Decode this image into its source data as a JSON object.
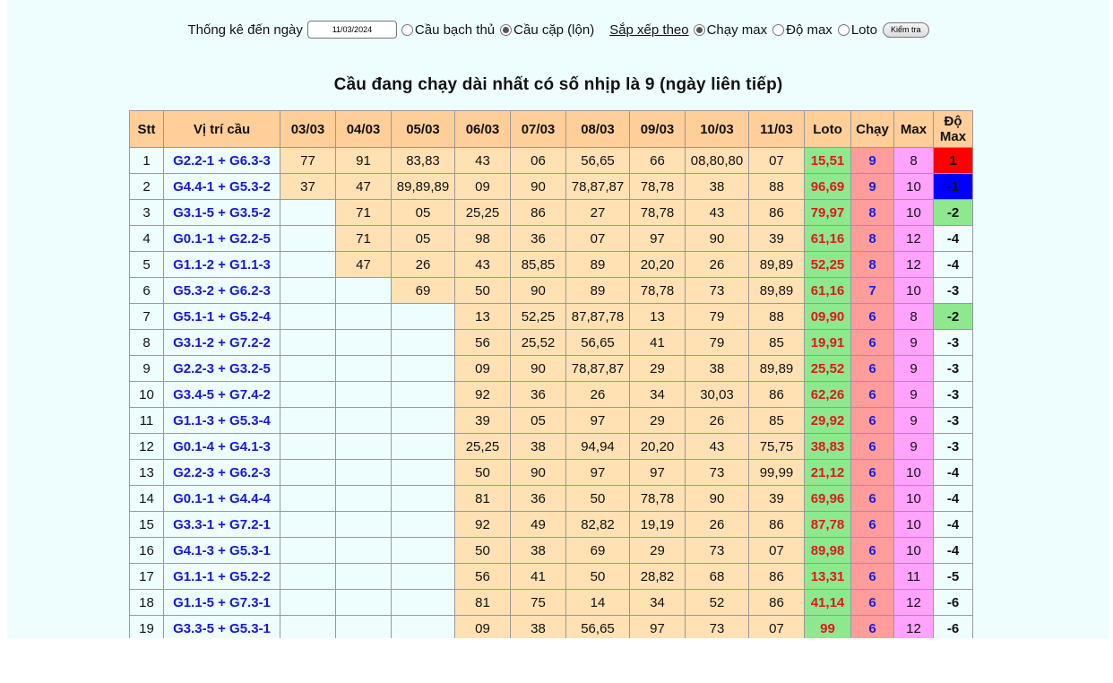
{
  "filter": {
    "date_label": "Thống kê đến ngày",
    "date_value": "11/03/2024",
    "mode_options": [
      {
        "label": "Cầu bạch thủ",
        "checked": false
      },
      {
        "label": "Cầu cặp (lộn)",
        "checked": true
      }
    ],
    "sort_label": "Sắp xếp theo",
    "sort_options": [
      {
        "label": "Chạy max",
        "checked": true
      },
      {
        "label": "Độ max",
        "checked": false
      },
      {
        "label": "Loto",
        "checked": false
      }
    ],
    "check_button": "Kiểm tra"
  },
  "title": "Cầu đang chạy dài nhất có số nhịp là 9 (ngày liên tiếp)",
  "table": {
    "headers": [
      "Stt",
      "Vị trí cầu",
      "03/03",
      "04/03",
      "05/03",
      "06/03",
      "07/03",
      "08/03",
      "09/03",
      "10/03",
      "11/03",
      "Loto",
      "Chạy",
      "Max",
      "Độ Max"
    ],
    "rows": [
      {
        "stt": "1",
        "pos": "G2.2-1 + G6.3-3",
        "days": [
          "77",
          "91",
          "83,83",
          "43",
          "06",
          "56,65",
          "66",
          "08,80,80",
          "07"
        ],
        "loto": "15,51",
        "chay": "9",
        "max": "8",
        "domax": "1",
        "domax_bg": "#ff0000",
        "domax_color": "#111111"
      },
      {
        "stt": "2",
        "pos": "G4.4-1 + G5.3-2",
        "days": [
          "37",
          "47",
          "89,89,89",
          "09",
          "90",
          "78,87,87",
          "78,78",
          "38",
          "88"
        ],
        "loto": "96,69",
        "chay": "9",
        "max": "10",
        "domax": "-1",
        "domax_bg": "#0000ff",
        "domax_color": "#111111"
      },
      {
        "stt": "3",
        "pos": "G3.1-5 + G3.5-2",
        "days": [
          "",
          "71",
          "05",
          "25,25",
          "86",
          "27",
          "78,78",
          "43",
          "86"
        ],
        "loto": "79,97",
        "chay": "8",
        "max": "10",
        "domax": "-2",
        "domax_bg": "#8ee88e",
        "domax_color": "#111111"
      },
      {
        "stt": "4",
        "pos": "G0.1-1 + G2.2-5",
        "days": [
          "",
          "71",
          "05",
          "98",
          "36",
          "07",
          "97",
          "90",
          "39"
        ],
        "loto": "61,16",
        "chay": "8",
        "max": "12",
        "domax": "-4",
        "domax_bg": "",
        "domax_color": "#111111"
      },
      {
        "stt": "5",
        "pos": "G1.1-2 + G1.1-3",
        "days": [
          "",
          "47",
          "26",
          "43",
          "85,85",
          "89",
          "20,20",
          "26",
          "89,89"
        ],
        "loto": "52,25",
        "chay": "8",
        "max": "12",
        "domax": "-4",
        "domax_bg": "",
        "domax_color": "#111111"
      },
      {
        "stt": "6",
        "pos": "G5.3-2 + G6.2-3",
        "days": [
          "",
          "",
          "69",
          "50",
          "90",
          "89",
          "78,78",
          "73",
          "89,89"
        ],
        "loto": "61,16",
        "chay": "7",
        "max": "10",
        "domax": "-3",
        "domax_bg": "",
        "domax_color": "#111111"
      },
      {
        "stt": "7",
        "pos": "G5.1-1 + G5.2-4",
        "days": [
          "",
          "",
          "",
          "13",
          "52,25",
          "87,87,78",
          "13",
          "79",
          "88"
        ],
        "loto": "09,90",
        "chay": "6",
        "max": "8",
        "domax": "-2",
        "domax_bg": "#8ee88e",
        "domax_color": "#111111"
      },
      {
        "stt": "8",
        "pos": "G3.1-2 + G7.2-2",
        "days": [
          "",
          "",
          "",
          "56",
          "25,52",
          "56,65",
          "41",
          "79",
          "85"
        ],
        "loto": "19,91",
        "chay": "6",
        "max": "9",
        "domax": "-3",
        "domax_bg": "",
        "domax_color": "#111111"
      },
      {
        "stt": "9",
        "pos": "G2.2-3 + G3.2-5",
        "days": [
          "",
          "",
          "",
          "09",
          "90",
          "78,87,87",
          "29",
          "38",
          "89,89"
        ],
        "loto": "25,52",
        "chay": "6",
        "max": "9",
        "domax": "-3",
        "domax_bg": "",
        "domax_color": "#111111"
      },
      {
        "stt": "10",
        "pos": "G3.4-5 + G7.4-2",
        "days": [
          "",
          "",
          "",
          "92",
          "36",
          "26",
          "34",
          "30,03",
          "86"
        ],
        "loto": "62,26",
        "chay": "6",
        "max": "9",
        "domax": "-3",
        "domax_bg": "",
        "domax_color": "#111111"
      },
      {
        "stt": "11",
        "pos": "G1.1-3 + G5.3-4",
        "days": [
          "",
          "",
          "",
          "39",
          "05",
          "97",
          "29",
          "26",
          "85"
        ],
        "loto": "29,92",
        "chay": "6",
        "max": "9",
        "domax": "-3",
        "domax_bg": "",
        "domax_color": "#111111"
      },
      {
        "stt": "12",
        "pos": "G0.1-4 + G4.1-3",
        "days": [
          "",
          "",
          "",
          "25,25",
          "38",
          "94,94",
          "20,20",
          "43",
          "75,75"
        ],
        "loto": "38,83",
        "chay": "6",
        "max": "9",
        "domax": "-3",
        "domax_bg": "",
        "domax_color": "#111111"
      },
      {
        "stt": "13",
        "pos": "G2.2-3 + G6.2-3",
        "days": [
          "",
          "",
          "",
          "50",
          "90",
          "97",
          "97",
          "73",
          "99,99"
        ],
        "loto": "21,12",
        "chay": "6",
        "max": "10",
        "domax": "-4",
        "domax_bg": "",
        "domax_color": "#111111"
      },
      {
        "stt": "14",
        "pos": "G0.1-1 + G4.4-4",
        "days": [
          "",
          "",
          "",
          "81",
          "36",
          "50",
          "78,78",
          "90",
          "39"
        ],
        "loto": "69,96",
        "chay": "6",
        "max": "10",
        "domax": "-4",
        "domax_bg": "",
        "domax_color": "#111111"
      },
      {
        "stt": "15",
        "pos": "G3.3-1 + G7.2-1",
        "days": [
          "",
          "",
          "",
          "92",
          "49",
          "82,82",
          "19,19",
          "26",
          "86"
        ],
        "loto": "87,78",
        "chay": "6",
        "max": "10",
        "domax": "-4",
        "domax_bg": "",
        "domax_color": "#111111"
      },
      {
        "stt": "16",
        "pos": "G4.1-3 + G5.3-1",
        "days": [
          "",
          "",
          "",
          "50",
          "38",
          "69",
          "29",
          "73",
          "07"
        ],
        "loto": "89,98",
        "chay": "6",
        "max": "10",
        "domax": "-4",
        "domax_bg": "",
        "domax_color": "#111111"
      },
      {
        "stt": "17",
        "pos": "G1.1-1 + G5.2-2",
        "days": [
          "",
          "",
          "",
          "56",
          "41",
          "50",
          "28,82",
          "68",
          "86"
        ],
        "loto": "13,31",
        "chay": "6",
        "max": "11",
        "domax": "-5",
        "domax_bg": "",
        "domax_color": "#111111"
      },
      {
        "stt": "18",
        "pos": "G1.1-5 + G7.3-1",
        "days": [
          "",
          "",
          "",
          "81",
          "75",
          "14",
          "34",
          "52",
          "86"
        ],
        "loto": "41,14",
        "chay": "6",
        "max": "12",
        "domax": "-6",
        "domax_bg": "",
        "domax_color": "#111111"
      },
      {
        "stt": "19",
        "pos": "G3.3-5 + G5.3-1",
        "days": [
          "",
          "",
          "",
          "09",
          "38",
          "56,65",
          "97",
          "73",
          "07"
        ],
        "loto": "99",
        "chay": "6",
        "max": "12",
        "domax": "-6",
        "domax_bg": "",
        "domax_color": "#111111"
      }
    ]
  }
}
